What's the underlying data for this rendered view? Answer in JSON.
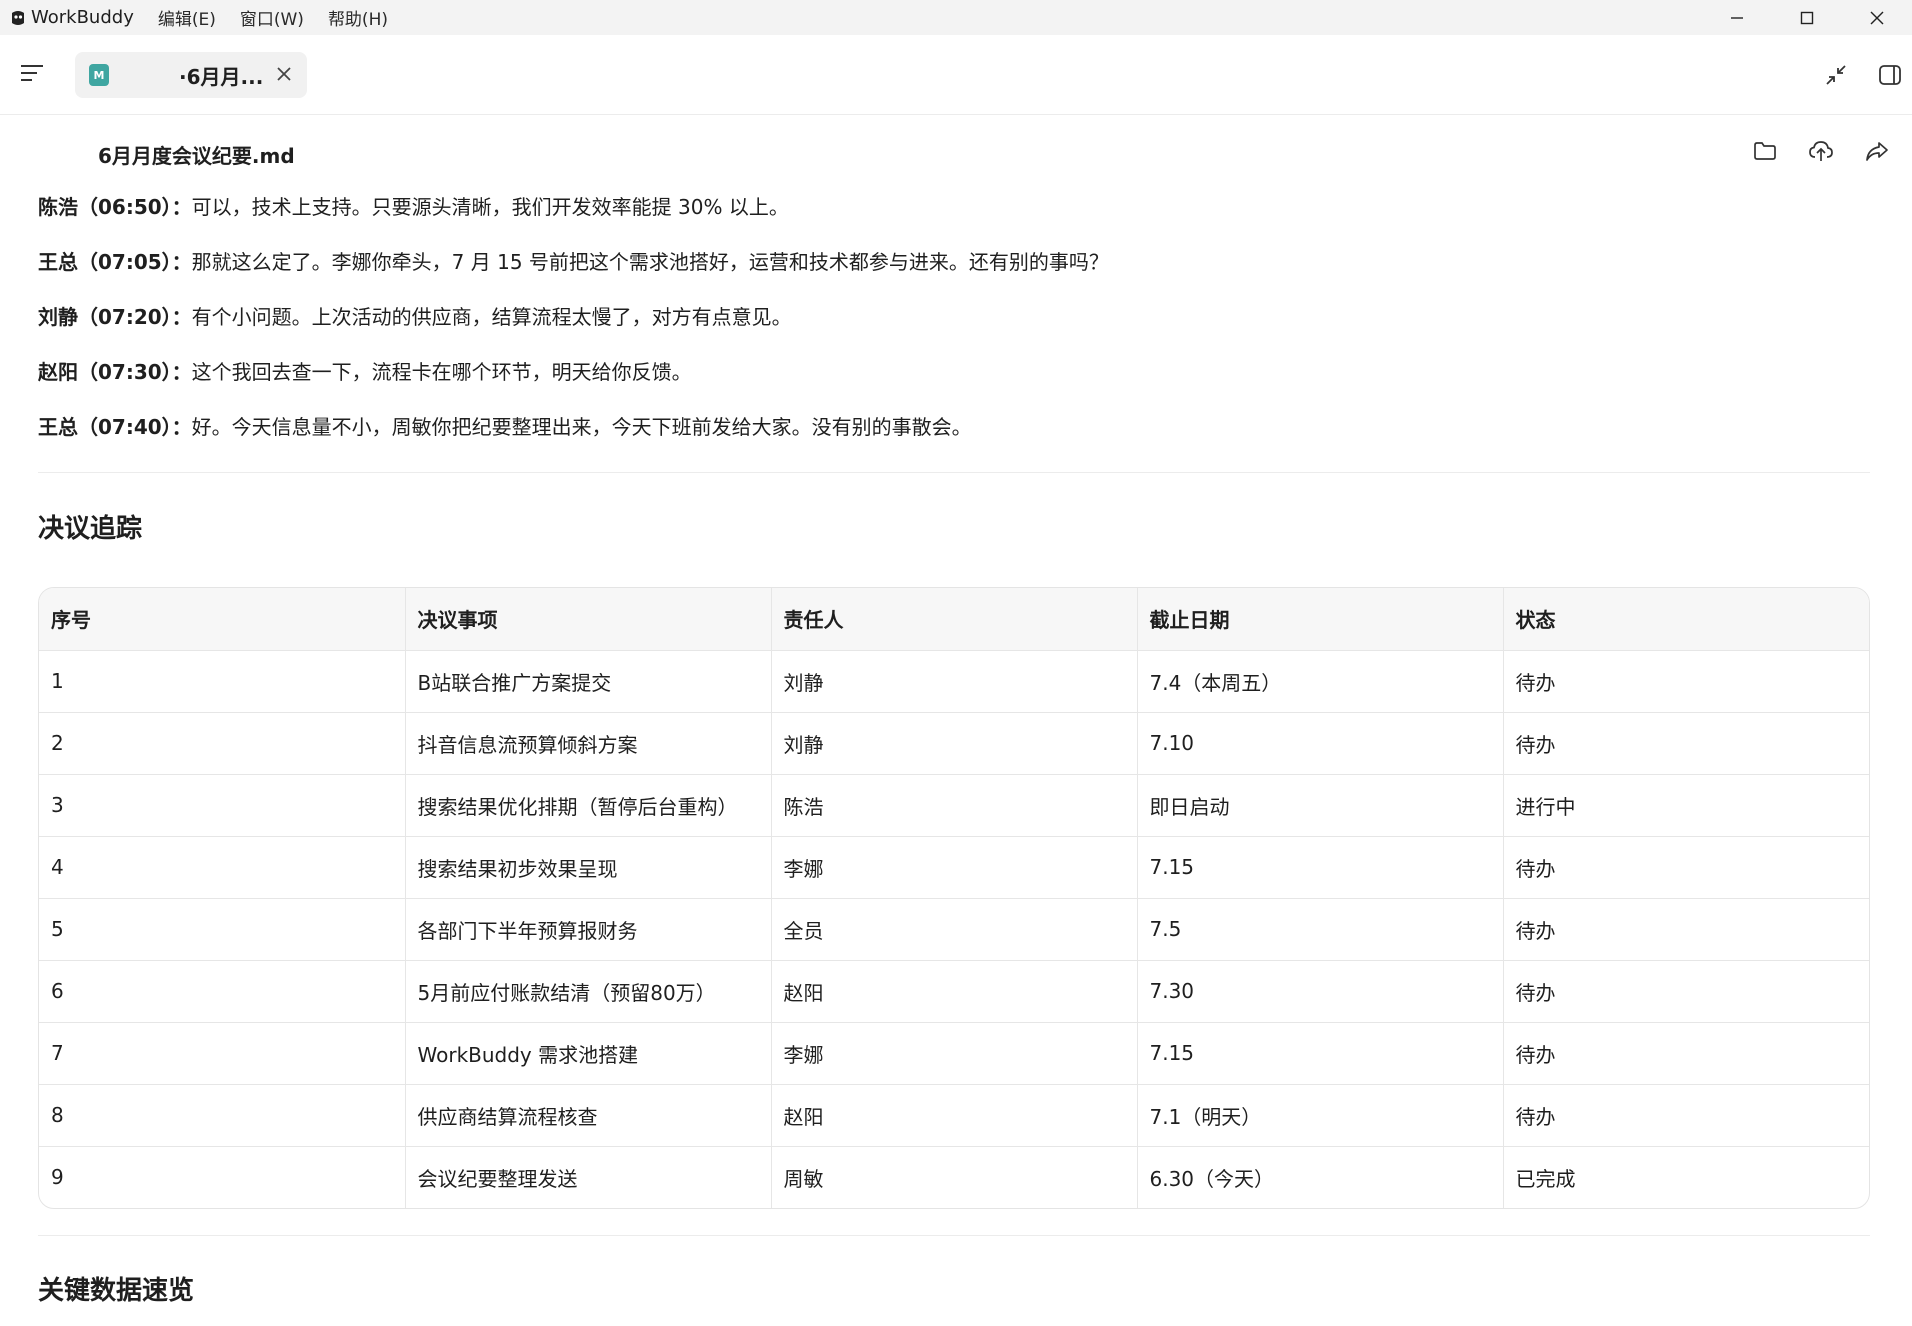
{
  "app": {
    "name": "WorkBuddy",
    "menu": [
      "编辑(E)",
      "窗口(W)",
      "帮助(H)"
    ]
  },
  "tab": {
    "title": "·6月月...",
    "icon_letter": "M",
    "icon_color": "#3fa6a1"
  },
  "document": {
    "filename": "6月月度会议纪要.md"
  },
  "transcript": [
    {
      "speaker": "陈浩（06:50）：",
      "text": "可以，技术上支持。只要源头清晰，我们开发效率能提 30% 以上。"
    },
    {
      "speaker": "王总（07:05）：",
      "text": "那就这么定了。李娜你牵头，7 月 15 号前把这个需求池搭好，运营和技术都参与进来。还有别的事吗？"
    },
    {
      "speaker": "刘静（07:20）：",
      "text": "有个小问题。上次活动的供应商，结算流程太慢了，对方有点意见。"
    },
    {
      "speaker": "赵阳（07:30）：",
      "text": "这个我回去查一下，流程卡在哪个环节，明天给你反馈。"
    },
    {
      "speaker": "王总（07:40）：",
      "text": "好。今天信息量不小，周敏你把纪要整理出来，今天下班前发给大家。没有别的事散会。"
    }
  ],
  "decisions": {
    "title": "决议追踪",
    "headers": [
      "序号",
      "决议事项",
      "责任人",
      "截止日期",
      "状态"
    ],
    "rows": [
      [
        "1",
        "B站联合推广方案提交",
        "刘静",
        "7.4（本周五）",
        "待办"
      ],
      [
        "2",
        "抖音信息流预算倾斜方案",
        "刘静",
        "7.10",
        "待办"
      ],
      [
        "3",
        "搜索结果优化排期（暂停后台重构）",
        "陈浩",
        "即日启动",
        "进行中"
      ],
      [
        "4",
        "搜索结果初步效果呈现",
        "李娜",
        "7.15",
        "待办"
      ],
      [
        "5",
        "各部门下半年预算报财务",
        "全员",
        "7.5",
        "待办"
      ],
      [
        "6",
        "5月前应付账款结清（预留80万）",
        "赵阳",
        "7.30",
        "待办"
      ],
      [
        "7",
        "WorkBuddy 需求池搭建",
        "李娜",
        "7.15",
        "待办"
      ],
      [
        "8",
        "供应商结算流程核查",
        "赵阳",
        "7.1（明天）",
        "待办"
      ],
      [
        "9",
        "会议纪要整理发送",
        "周敏",
        "6.30（今天）",
        "已完成"
      ]
    ]
  },
  "key_data": {
    "title": "关键数据速览"
  }
}
